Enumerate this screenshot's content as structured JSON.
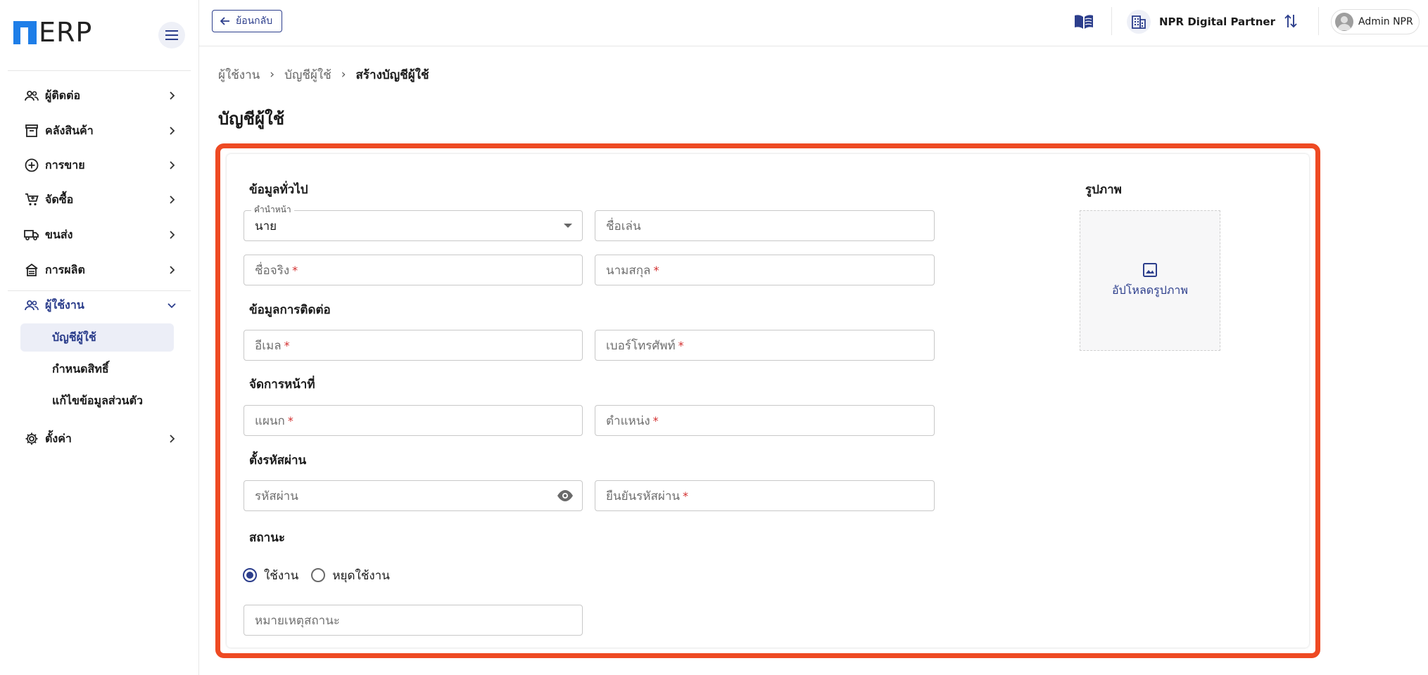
{
  "app": {
    "logo_text": "ERP"
  },
  "sidebar": {
    "items": [
      {
        "label": "ผู้ติดต่อ",
        "icon": "contacts-icon"
      },
      {
        "label": "คลังสินค้า",
        "icon": "archive-icon"
      },
      {
        "label": "การขาย",
        "icon": "add-circle-icon"
      },
      {
        "label": "จัดซื้อ",
        "icon": "cart-icon"
      },
      {
        "label": "ขนส่ง",
        "icon": "truck-icon"
      },
      {
        "label": "การผลิต",
        "icon": "factory-icon"
      },
      {
        "label": "ผู้ใช้งาน",
        "icon": "users-icon",
        "expanded": true
      },
      {
        "label": "ตั้งค่า",
        "icon": "gear-icon"
      }
    ],
    "sub_items": [
      {
        "label": "บัญชีผู้ใช้",
        "selected": true
      },
      {
        "label": "กำหนดสิทธิ์"
      },
      {
        "label": "แก้ไขข้อมูลส่วนตัว"
      }
    ]
  },
  "topbar": {
    "back_label": "ย้อนกลับ",
    "company_name": "NPR Digital Partner",
    "user_name": "Admin NPR"
  },
  "breadcrumb": {
    "items": [
      "ผู้ใช้งาน",
      "บัญชีผู้ใช้",
      "สร้างบัญชีผู้ใช้"
    ]
  },
  "page": {
    "title": "บัญชีผู้ใช้"
  },
  "form": {
    "general": {
      "title": "ข้อมูลทั่วไป",
      "prefix_label": "คำนำหน้า",
      "prefix_value": "นาย",
      "nickname_placeholder": "ชื่อเล่น",
      "first_name_placeholder": "ชื่อจริง",
      "last_name_placeholder": "นามสกุล"
    },
    "contact": {
      "title": "ข้อมูลการติดต่อ",
      "email_placeholder": "อีเมล",
      "phone_placeholder": "เบอร์โทรศัพท์"
    },
    "duty": {
      "title": "จัดการหน้าที่",
      "department_placeholder": "แผนก",
      "position_placeholder": "ตำแหน่ง"
    },
    "password": {
      "title": "ตั้งรหัสผ่าน",
      "password_placeholder": "รหัสผ่าน",
      "confirm_placeholder": "ยืนยันรหัสผ่าน"
    },
    "status": {
      "title": "สถานะ",
      "options": [
        "ใช้งาน",
        "หยุดใช้งาน"
      ],
      "selected": "ใช้งาน",
      "remark_placeholder": "หมายเหตุสถานะ"
    },
    "image": {
      "title": "รูปภาพ",
      "upload_label": "อัปโหลดรูปภาพ"
    },
    "required_mark": "*"
  },
  "colors": {
    "primary": "#2c3e8c",
    "logo_blue": "#1e7ee8",
    "highlight": "#ee4a23",
    "required": "#d32f2f"
  }
}
